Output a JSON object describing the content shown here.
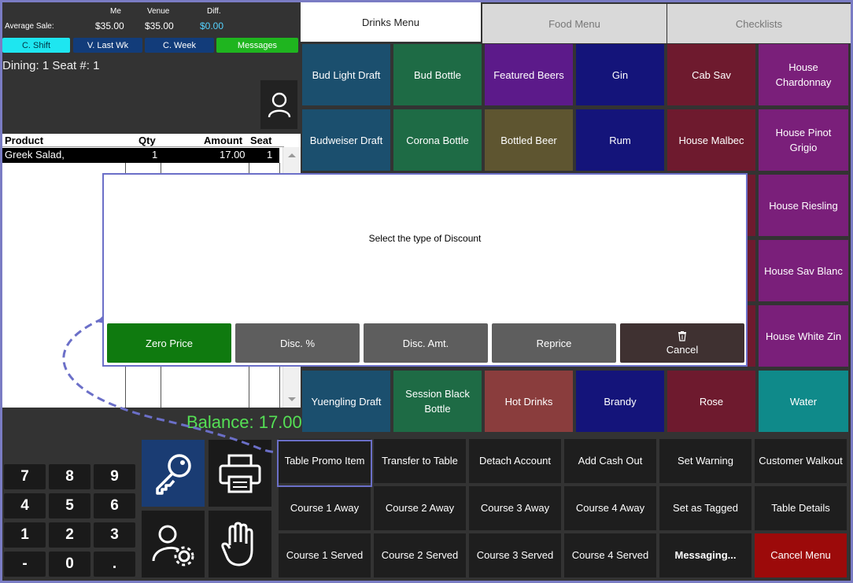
{
  "stats": {
    "row_label": "Average Sale:",
    "columns": [
      {
        "header": "Me",
        "value": "$35.00",
        "color": "#ffffff"
      },
      {
        "header": "Venue",
        "value": "$35.00",
        "color": "#ffffff"
      },
      {
        "header": "Diff.",
        "value": "$0.00",
        "color": "#55d3ff"
      }
    ],
    "filters": [
      {
        "label": "C. Shift",
        "bg": "#1ee6f0",
        "fg": "#003344"
      },
      {
        "label": "V. Last Wk",
        "bg": "#123c7a",
        "fg": "#ffffff"
      },
      {
        "label": "C. Week",
        "bg": "#123c7a",
        "fg": "#ffffff"
      },
      {
        "label": "Messages",
        "bg": "#1fb51f",
        "fg": "#ffffff"
      }
    ]
  },
  "dining_info": "Dining: 1  Seat #: 1",
  "order": {
    "headers": {
      "product": "Product",
      "qty": "Qty",
      "amount": "Amount",
      "seat": "Seat"
    },
    "rows": [
      {
        "product": "Greek Salad,",
        "qty": "1",
        "amount": "17.00",
        "seat": "1"
      }
    ],
    "balance": "Balance: 17.00"
  },
  "keypad": [
    "7",
    "8",
    "9",
    "4",
    "5",
    "6",
    "1",
    "2",
    "3",
    "-",
    "0",
    "."
  ],
  "tabs": [
    "Drinks Menu",
    "Food Menu",
    "Checklists"
  ],
  "menu_rows": [
    [
      {
        "label": "Bud Light Draft",
        "bg": "#1b4f6e"
      },
      {
        "label": "Bud Bottle",
        "bg": "#1e6b45"
      },
      {
        "label": "Featured Beers",
        "bg": "#5c1a8a"
      },
      {
        "label": "Gin",
        "bg": "#14147a"
      },
      {
        "label": "Cab Sav",
        "bg": "#6e1a2e"
      },
      {
        "label": "House Chardonnay",
        "bg": "#7a1f7a"
      }
    ],
    [
      {
        "label": "Budweiser Draft",
        "bg": "#1b4f6e"
      },
      {
        "label": "Corona Bottle",
        "bg": "#1e6b45"
      },
      {
        "label": "Bottled Beer",
        "bg": "#5e5530"
      },
      {
        "label": "Rum",
        "bg": "#14147a"
      },
      {
        "label": "House Malbec",
        "bg": "#6e1a2e"
      },
      {
        "label": "House Pinot Grigio",
        "bg": "#7a1f7a"
      }
    ],
    [
      {
        "label": "",
        "bg": "#1b4f6e"
      },
      {
        "label": "",
        "bg": "#1e6b45"
      },
      {
        "label": "",
        "bg": "#5c1a8a"
      },
      {
        "label": "",
        "bg": "#14147a"
      },
      {
        "label": "",
        "bg": "#6e1a2e"
      },
      {
        "label": "House Riesling",
        "bg": "#7a1f7a"
      }
    ],
    [
      {
        "label": "",
        "bg": "#1b4f6e"
      },
      {
        "label": "",
        "bg": "#1e6b45"
      },
      {
        "label": "",
        "bg": "#5c1a8a"
      },
      {
        "label": "",
        "bg": "#14147a"
      },
      {
        "label": "",
        "bg": "#6e1a2e"
      },
      {
        "label": "House Sav Blanc",
        "bg": "#7a1f7a"
      }
    ],
    [
      {
        "label": "",
        "bg": "#1b4f6e"
      },
      {
        "label": "",
        "bg": "#1e6b45"
      },
      {
        "label": "",
        "bg": "#5c1a8a"
      },
      {
        "label": "",
        "bg": "#14147a"
      },
      {
        "label": "",
        "bg": "#6e1a2e"
      },
      {
        "label": "House White Zin",
        "bg": "#7a1f7a"
      }
    ],
    [
      {
        "label": "Yuengling Draft",
        "bg": "#1b4f6e"
      },
      {
        "label": "Session Black Bottle",
        "bg": "#1e6b45"
      },
      {
        "label": "Hot Drinks",
        "bg": "#8a3d3d"
      },
      {
        "label": "Brandy",
        "bg": "#14147a"
      },
      {
        "label": "Rose",
        "bg": "#6e1a2e"
      },
      {
        "label": "Water",
        "bg": "#0f8a8a"
      }
    ]
  ],
  "actions": [
    [
      "Table Promo Item",
      "Transfer to Table",
      "Detach Account",
      "Add Cash Out",
      "Set Warning",
      "Customer Walkout"
    ],
    [
      "Course 1 Away",
      "Course 2 Away",
      "Course 3 Away",
      "Course 4 Away",
      "Set as Tagged",
      "Table Details"
    ],
    [
      "Course 1 Served",
      "Course 2 Served",
      "Course 3 Served",
      "Course 4 Served",
      "Messaging...",
      "Cancel Menu"
    ]
  ],
  "dialog": {
    "message": "Select the type of Discount",
    "buttons": [
      {
        "label": "Zero Price",
        "bg": "#0f7a0f"
      },
      {
        "label": "Disc. %",
        "bg": "#5e5e5e"
      },
      {
        "label": "Disc. Amt.",
        "bg": "#5e5e5e"
      },
      {
        "label": "Reprice",
        "bg": "#5e5e5e"
      },
      {
        "label": "Cancel",
        "bg": "#3f3131",
        "icon": "trash-icon"
      }
    ]
  },
  "colors": {
    "accent": "#6b6fc8",
    "balance": "#55e055",
    "cancel_menu": "#9c0a0a",
    "key_tile": "#1a3c73"
  }
}
